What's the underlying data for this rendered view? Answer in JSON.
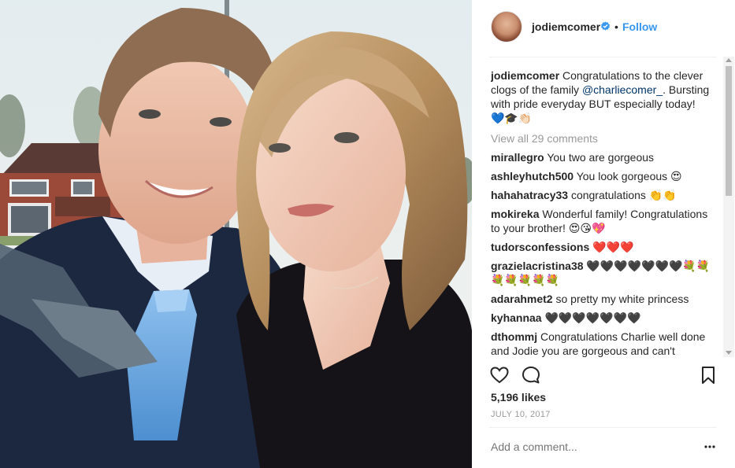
{
  "post": {
    "username": "jodiemcomer",
    "separator": "•",
    "follow_label": "Follow",
    "caption_user": "jodiemcomer",
    "caption_text_1": " Congratulations to the clever clogs of the family ",
    "caption_mention": "@charliecomer_",
    "caption_text_2": ". Bursting with pride everyday BUT especially today! ",
    "caption_emojis": "💙🎓👏🏻",
    "view_all": "View all 29 comments",
    "likes": "5,196 likes",
    "date": "JULY 10, 2017",
    "add_comment_placeholder": "Add a comment..."
  },
  "comments": [
    {
      "user": "mirallegro",
      "text": "You two are gorgeous"
    },
    {
      "user": "ashleyhutch500",
      "text": "You look gorgeous 😍"
    },
    {
      "user": "hahahatracy33",
      "text": "congratulations 👏👏"
    },
    {
      "user": "mokireka",
      "text": "Wonderful family! Congratulations to your brother! 😍😘💖"
    },
    {
      "user": "tudorsconfessions",
      "text": "❤️❤️❤️"
    },
    {
      "user": "grazielacristina38",
      "text": "🖤🖤🖤🖤🖤🖤🖤💐💐 💐💐💐💐💐"
    },
    {
      "user": "adarahmet2",
      "text": "so pretty my white princess"
    },
    {
      "user": "kyhannaa",
      "text": "🖤🖤🖤🖤🖤🖤🖤"
    },
    {
      "user": "dthommj",
      "text": "Congratulations Charlie well done and Jodie you are gorgeous and can't"
    }
  ],
  "icons": {
    "verified": "verified-badge-icon",
    "like": "heart-icon",
    "comment": "comment-bubble-icon",
    "save": "bookmark-icon",
    "more": "more-options-icon"
  },
  "colors": {
    "link": "#3897f0",
    "text": "#262626",
    "muted": "#999999",
    "mention": "#003569"
  }
}
